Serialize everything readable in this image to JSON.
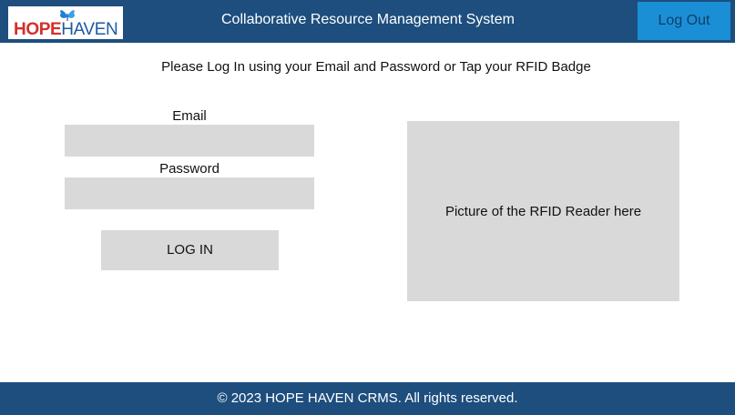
{
  "header": {
    "logo": {
      "part1": "HOPE",
      "part2": "HAVEN"
    },
    "title": "Collaborative Resource Management System",
    "logout_label": "Log Out"
  },
  "main": {
    "instructions": "Please Log In using your Email and Password or Tap your RFID Badge",
    "email_label": "Email",
    "email_value": "",
    "password_label": "Password",
    "password_value": "",
    "login_label": "LOG IN",
    "rfid_placeholder": "Picture of the RFID Reader here"
  },
  "footer": {
    "copyright": "© 2023 HOPE HAVEN CRMS. All rights reserved."
  },
  "colors": {
    "header_bg": "#1d4e7e",
    "logout_bg": "#1b8fd6",
    "panel_gray": "#d9d9d9",
    "logo_red": "#d42f2a",
    "logo_blue": "#1e5aa0"
  },
  "icons": [
    "butterfly-logo-icon"
  ]
}
